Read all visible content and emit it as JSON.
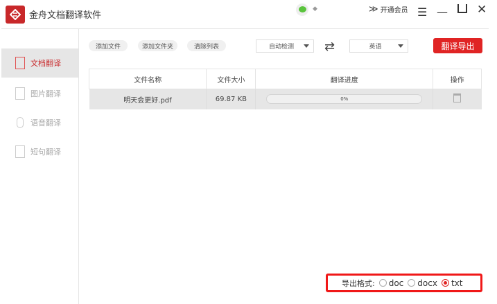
{
  "app": {
    "title": "金舟文档翻译软件",
    "member_label": "开通会员"
  },
  "sidebar": {
    "items": [
      {
        "label": "文档翻译",
        "active": true
      },
      {
        "label": "图片翻译"
      },
      {
        "label": "语音翻译"
      },
      {
        "label": "短句翻译"
      }
    ]
  },
  "toolbar": {
    "add_file": "添加文件",
    "add_folder": "添加文件夹",
    "clear_list": "清除列表",
    "source_lang": "自动检测",
    "target_lang": "英语",
    "translate_export": "翻译导出"
  },
  "table": {
    "headers": [
      "文件名称",
      "文件大小",
      "翻译进度",
      "操作"
    ],
    "rows": [
      {
        "name": "明天会更好.pdf",
        "size": "69.87 KB",
        "progress": "0%"
      }
    ]
  },
  "export": {
    "label": "导出格式:",
    "options": [
      "doc",
      "docx",
      "txt"
    ],
    "selected": "txt"
  },
  "colors": {
    "accent": "#e02424"
  }
}
